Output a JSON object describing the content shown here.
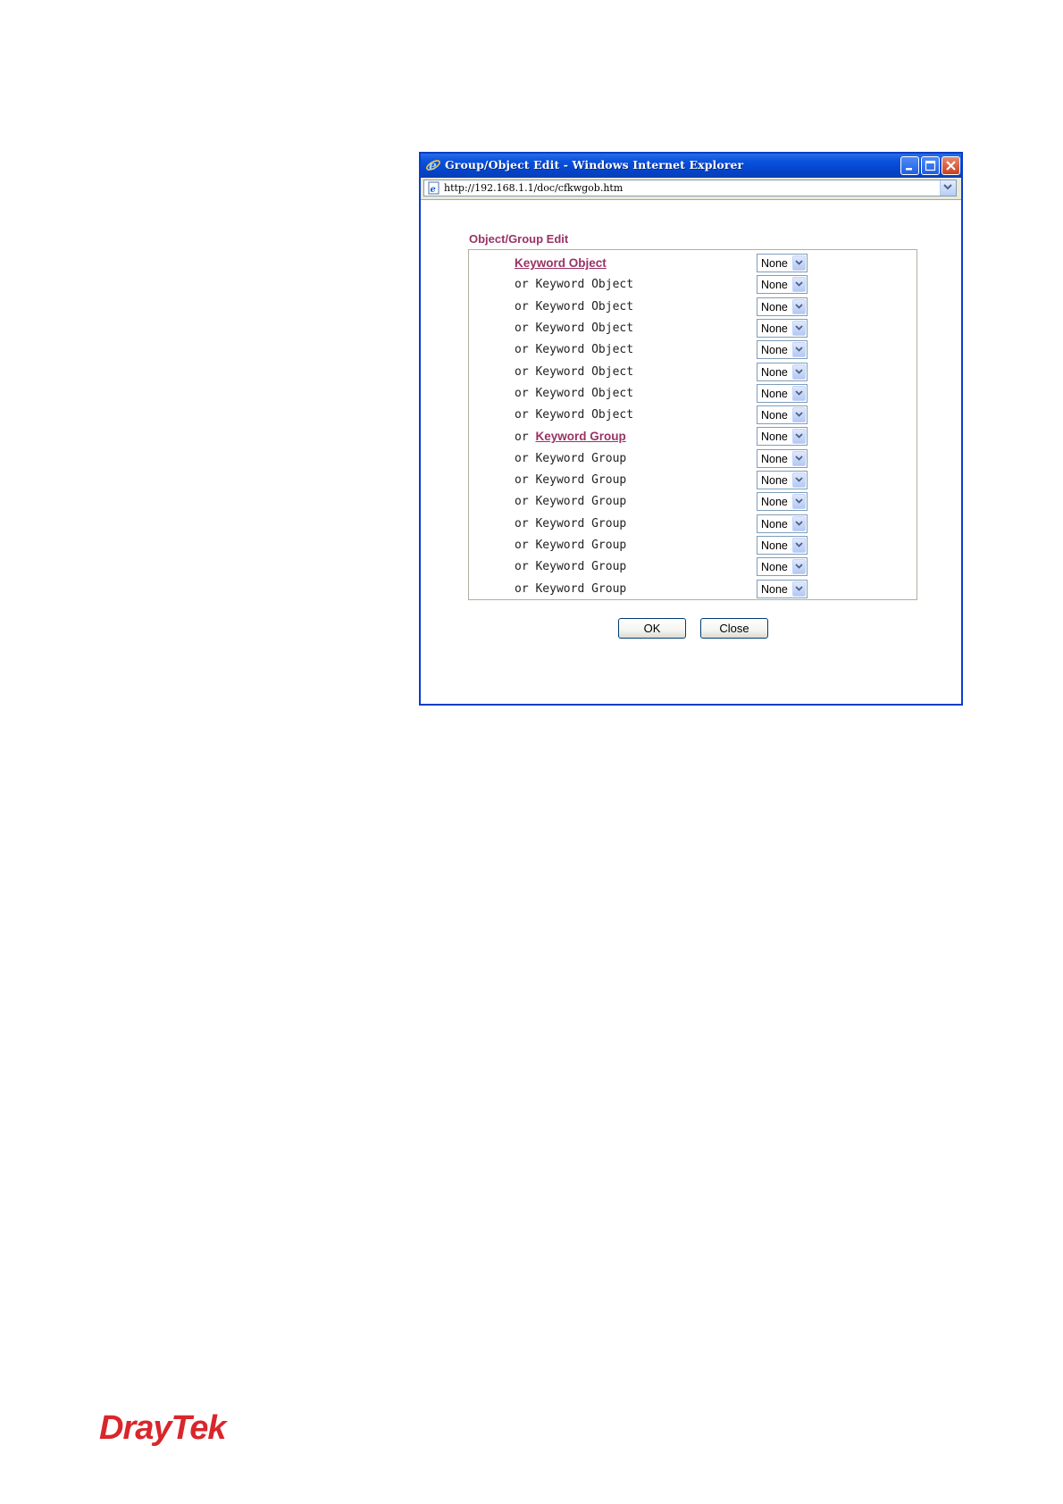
{
  "window": {
    "title": "Group/Object Edit - Windows Internet Explorer",
    "address": "http://192.168.1.1/doc/cfkwgob.htm"
  },
  "page": {
    "section_title": "Object/Group Edit",
    "rows": [
      {
        "prefix": "",
        "label": "Keyword Object",
        "link": true,
        "value": "None"
      },
      {
        "prefix": "or",
        "label": "Keyword Object",
        "link": false,
        "value": "None"
      },
      {
        "prefix": "or",
        "label": "Keyword Object",
        "link": false,
        "value": "None"
      },
      {
        "prefix": "or",
        "label": "Keyword Object",
        "link": false,
        "value": "None"
      },
      {
        "prefix": "or",
        "label": "Keyword Object",
        "link": false,
        "value": "None"
      },
      {
        "prefix": "or",
        "label": "Keyword Object",
        "link": false,
        "value": "None"
      },
      {
        "prefix": "or",
        "label": "Keyword Object",
        "link": false,
        "value": "None"
      },
      {
        "prefix": "or",
        "label": "Keyword Object",
        "link": false,
        "value": "None"
      },
      {
        "prefix": "or",
        "label": "Keyword Group",
        "link": true,
        "value": "None"
      },
      {
        "prefix": "or",
        "label": "Keyword Group",
        "link": false,
        "value": "None"
      },
      {
        "prefix": "or",
        "label": "Keyword Group",
        "link": false,
        "value": "None"
      },
      {
        "prefix": "or",
        "label": "Keyword Group",
        "link": false,
        "value": "None"
      },
      {
        "prefix": "or",
        "label": "Keyword Group",
        "link": false,
        "value": "None"
      },
      {
        "prefix": "or",
        "label": "Keyword Group",
        "link": false,
        "value": "None"
      },
      {
        "prefix": "or",
        "label": "Keyword Group",
        "link": false,
        "value": "None"
      },
      {
        "prefix": "or",
        "label": "Keyword Group",
        "link": false,
        "value": "None"
      }
    ],
    "ok_label": "OK",
    "close_label": "Close"
  },
  "brand": {
    "name": "DrayTek"
  },
  "colors": {
    "title_accent": "#993366",
    "titlebar": "#0a52de",
    "brand": "#d9262a"
  },
  "icons": [
    "ie-logo-icon",
    "minimize-icon",
    "maximize-icon",
    "close-icon",
    "page-icon",
    "chevron-down-icon"
  ]
}
